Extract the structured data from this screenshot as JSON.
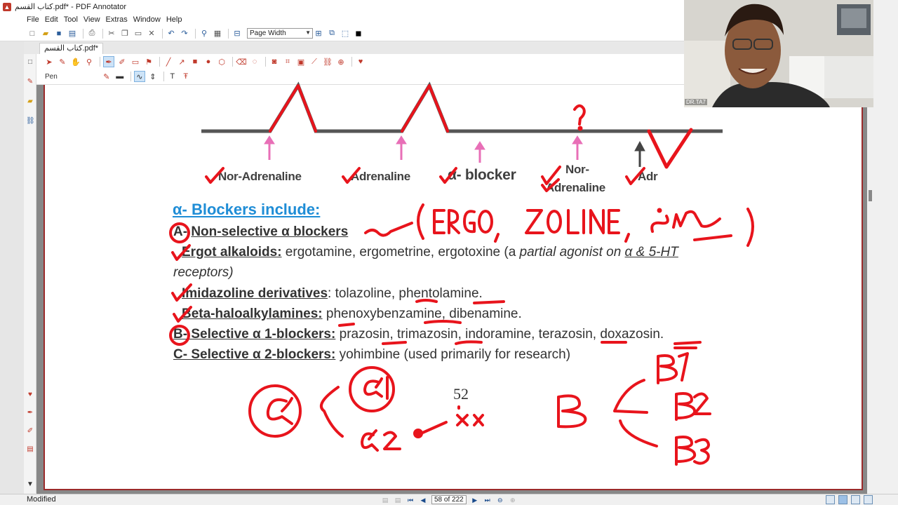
{
  "window": {
    "title": "كتاب القسم.pdf* - PDF Annotator",
    "app_icon": "pdf-annotator-icon"
  },
  "menu": [
    "File",
    "Edit",
    "Tool",
    "View",
    "Extras",
    "Window",
    "Help"
  ],
  "toolbar": {
    "zoom_value": "Page Width"
  },
  "tab": {
    "label": "كتاب القسم.pdf*"
  },
  "annotation_toolbar": {
    "current_tool": "Pen"
  },
  "page_content": {
    "waveform_labels": [
      "Nor-Adrenaline",
      "Adrenaline",
      "α- blocker",
      "Nor-",
      "Adrenaline",
      "Adr"
    ],
    "heading": "α- Blockers include:",
    "lines": {
      "a_prefix": "A- ",
      "a_title": "Non-selective α blockers",
      "ergot_title": "Ergot alkaloids:",
      "ergot_text": " ergotamine, ergometrine, ergotoxine (a ",
      "ergot_italic": "partial agonist on ",
      "ergot_italic_u": "α & 5-HT",
      "ergot_cont": "receptors)",
      "imid_title": "Imidazoline derivatives",
      "imid_text": ": tolazoline, phentolamine.",
      "beta_title": "Beta-haloalkylamines:",
      "beta_text": " phenoxybenzamine, dibenamine.",
      "b_title": "B- Selective α 1-blockers:",
      "b_text": " prazosin, trimazosin, indoramine, terazosin, doxazosin.",
      "c_title": "C- Selective α 2-blockers:",
      "c_text": " yohimbine (used primarily for research)"
    },
    "page_number": "52"
  },
  "webcam": {
    "label": "DR.TA7"
  },
  "status": {
    "text": "Modified",
    "page_field": "58 of 222"
  },
  "colors": {
    "ink_red": "#e8141c",
    "heading_blue": "#1f8dd6",
    "arrow_pink": "#e86fb7",
    "page_border": "#9b2a2a"
  }
}
